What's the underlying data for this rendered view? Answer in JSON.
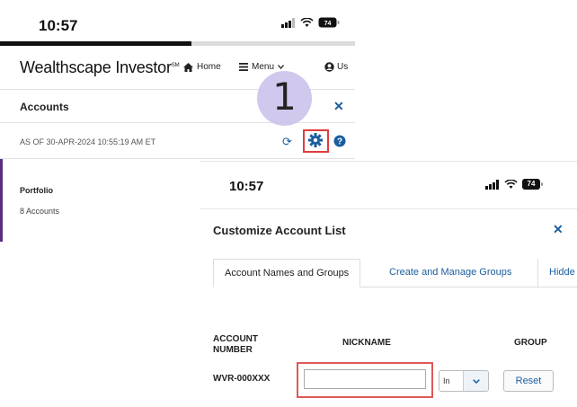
{
  "back_screen": {
    "status_time": "10:57",
    "progress": 0.54,
    "brand": "Wealthscape Investor",
    "brand_mark": "SM",
    "nav": {
      "home": "Home",
      "menu": "Menu",
      "user": "Us"
    },
    "accounts_title": "Accounts",
    "as_of": "AS OF 30-APR-2024 10:55:19 AM ET",
    "portfolio": {
      "name": "Portfolio",
      "count": "8 Accounts"
    },
    "step_number": "1",
    "colors": {
      "link": "#1a5e9e",
      "highlight": "#e03c3c",
      "portfolio_accent": "#5a2d82",
      "step_circle": "#cdc4ec"
    },
    "icons": [
      "signal-icon",
      "wifi-icon",
      "battery-icon",
      "home-icon",
      "menu-icon",
      "user-icon",
      "refresh-icon",
      "gear-icon",
      "help-icon",
      "close-icon"
    ]
  },
  "front_screen": {
    "status_time": "10:57",
    "battery": "74",
    "title": "Customize Account List",
    "tabs": [
      {
        "label": "Account Names and Groups",
        "active": true
      },
      {
        "label": "Create and Manage Groups",
        "active": false
      },
      {
        "label": "Hidde",
        "active": false
      }
    ],
    "columns": {
      "account": "ACCOUNT NUMBER",
      "nickname": "NICKNAME",
      "group": "GROUP"
    },
    "row": {
      "account_number": "WVR-000XXX",
      "nickname_value": "",
      "group_value": "In",
      "reset_label": "Reset"
    }
  }
}
